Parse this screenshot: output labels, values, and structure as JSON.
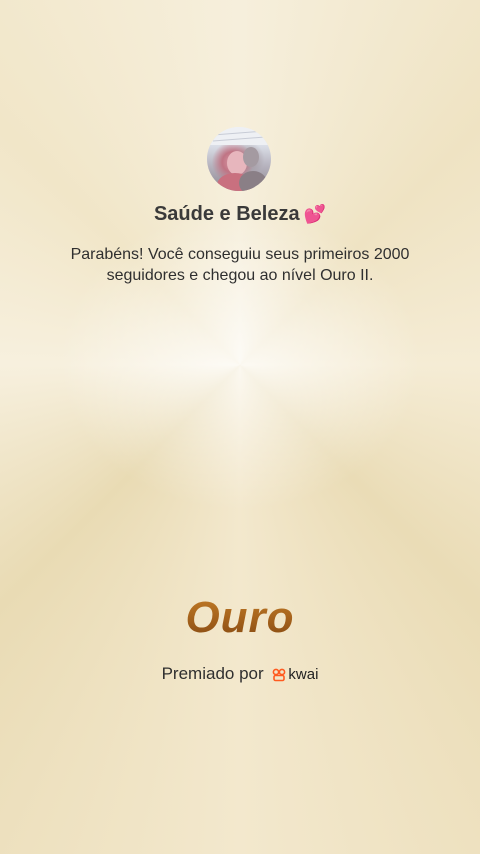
{
  "profile": {
    "name": "Saúde e Beleza",
    "name_emoji": "💕",
    "avatar_icon": "profile-photo"
  },
  "message": "Parabéns! Você conseguiu seus primeiros 2000 seguidores e chegou ao nível Ouro II.",
  "level": {
    "label": "Ouro",
    "color": "#a6631c"
  },
  "awarded": {
    "label": "Premiado por",
    "brand": "kwai",
    "brand_icon": "kwai-logo-icon",
    "brand_color": "#ff5a1f"
  }
}
